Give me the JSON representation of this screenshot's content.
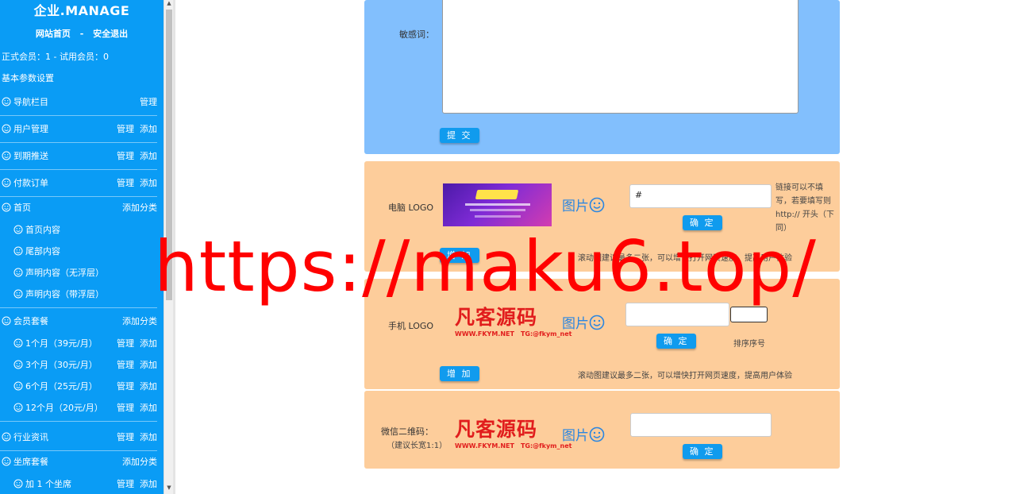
{
  "sidebar": {
    "brand": "企业.MANAGE",
    "top_links": {
      "home": "网站首页",
      "sep": "-",
      "logout": "安全退出"
    },
    "member_stats": "正式会员：1  -  试用会员：0",
    "basic_settings": "基本参数设置",
    "rows": [
      {
        "label": "导航栏目",
        "type": "group",
        "actions": [
          "管理"
        ]
      },
      {
        "label": "用户管理",
        "type": "group",
        "actions": [
          "管理",
          "添加"
        ]
      },
      {
        "label": "到期推送",
        "type": "group",
        "actions": [
          "管理",
          "添加"
        ]
      },
      {
        "label": "付款订单",
        "type": "group",
        "actions": [
          "管理",
          "添加"
        ]
      },
      {
        "label": "首页",
        "type": "groupnb",
        "actions": [
          "添加分类"
        ]
      },
      {
        "label": "首页内容",
        "type": "sub",
        "actions": []
      },
      {
        "label": "尾部内容",
        "type": "sub",
        "actions": []
      },
      {
        "label": "声明内容（无浮层）",
        "type": "sub",
        "actions": []
      },
      {
        "label": "声明内容（带浮层）",
        "type": "sub",
        "actions": []
      },
      {
        "label": "会员套餐",
        "type": "groupline",
        "actions": [
          "添加分类"
        ]
      },
      {
        "label": "1个月（39元/月）",
        "type": "sub",
        "actions": [
          "管理",
          "添加"
        ]
      },
      {
        "label": "3个月（30元/月）",
        "type": "sub",
        "actions": [
          "管理",
          "添加"
        ]
      },
      {
        "label": "6个月（25元/月）",
        "type": "sub",
        "actions": [
          "管理",
          "添加"
        ]
      },
      {
        "label": "12个月（20元/月）",
        "type": "sub",
        "actions": [
          "管理",
          "添加"
        ]
      },
      {
        "label": "行业资讯",
        "type": "group",
        "actions": [
          "管理",
          "添加"
        ]
      },
      {
        "label": "坐席套餐",
        "type": "groupnb",
        "actions": [
          "添加分类"
        ]
      },
      {
        "label": "加 1 个坐席",
        "type": "sub",
        "actions": [
          "管理",
          "添加"
        ]
      }
    ]
  },
  "keywords_panel": {
    "label": "敏感词：",
    "value": "",
    "submit": "提 交"
  },
  "pc_logo": {
    "label": "电脑 LOGO",
    "pic_link": "图片",
    "url_value": "#",
    "confirm": "确 定",
    "hint": "链接可以不填写，若要填写则 http:// 开头（下同）",
    "add": "增 加",
    "tip": "滚动图建议最多二张，可以增快打开网页速度，提高用户体验"
  },
  "mobile_logo": {
    "label": "手机 LOGO",
    "logo_text": "凡客源码",
    "logo_sub_1": "WWW.FKYM.NET",
    "logo_sub_2": "TG:@fkym_net",
    "pic_link": "图片",
    "url_value": "",
    "confirm": "确 定",
    "sort_label": "排序序号",
    "add": "增 加",
    "tip": "滚动图建议最多二张，可以增快打开网页速度，提高用户体验"
  },
  "wechat_qr": {
    "label": "微信二维码：",
    "sublabel": "（建议长宽1:1）",
    "logo_text": "凡客源码",
    "logo_sub_1": "WWW.FKYM.NET",
    "logo_sub_2": "TG:@fkym_net",
    "pic_link": "图片",
    "url_value": "",
    "confirm": "确 定"
  },
  "watermark": "https://maku6.top/",
  "colors": {
    "sidebar": "#0a9cf5",
    "panel_blue": "#82bffd",
    "panel_orange": "#fdcd9b",
    "button": "#109bee",
    "watermark": "#ff0000"
  },
  "icons": {
    "menu": "smile-icon",
    "picture": "smile-icon"
  }
}
